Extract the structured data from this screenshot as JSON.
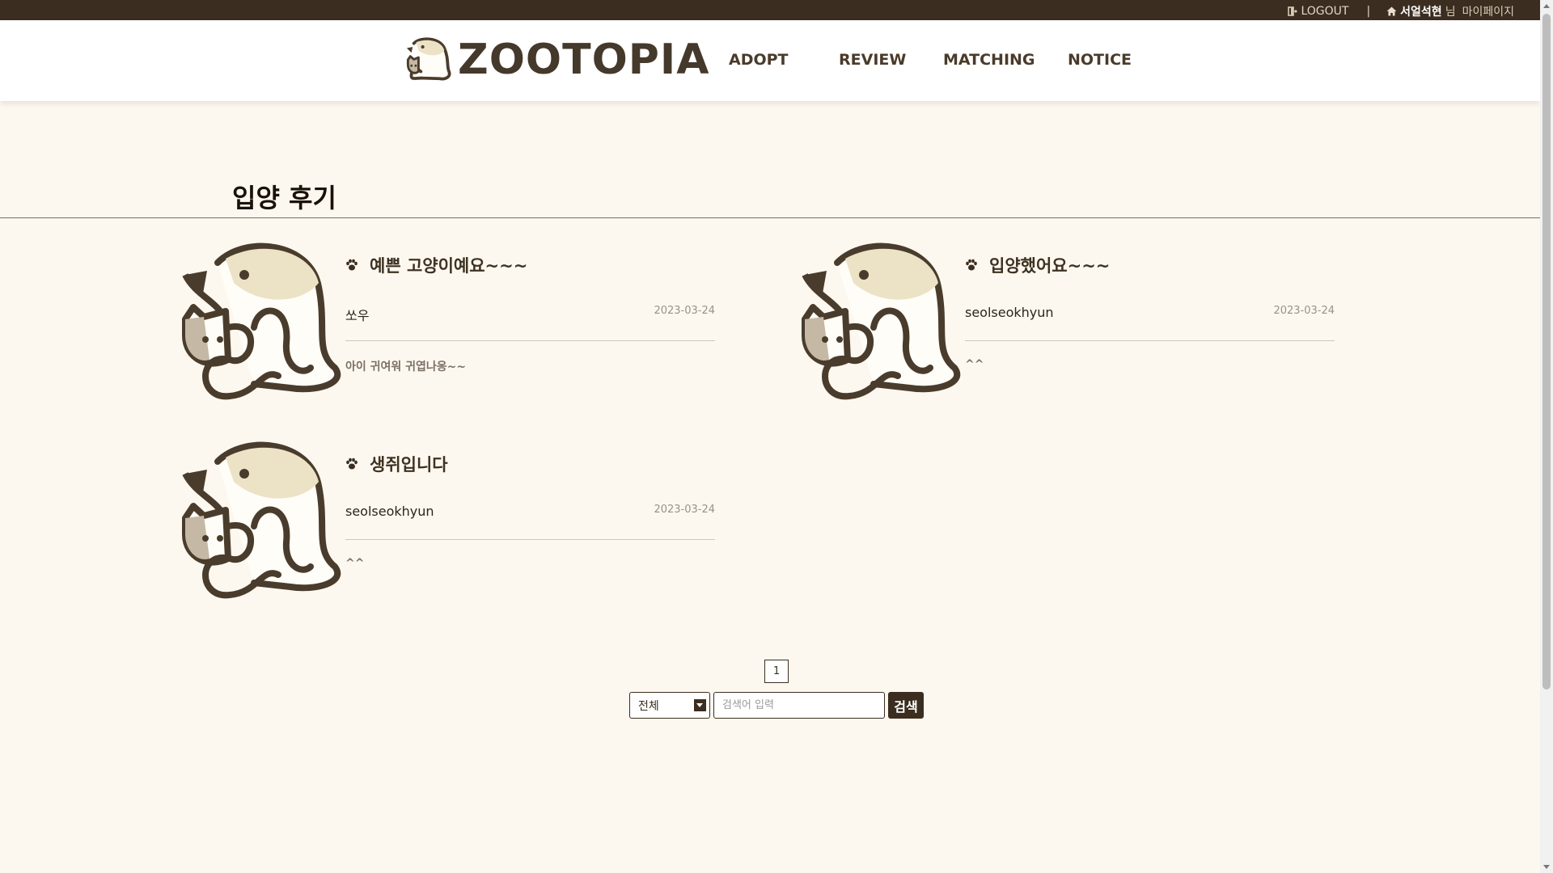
{
  "topbar": {
    "logout_label": "LOGOUT",
    "separator": "|",
    "username": "서얼석현",
    "suffix": "님",
    "mypage_label": "마이페이지"
  },
  "header": {
    "logo_text": "ZOOTOPIA",
    "nav": [
      {
        "label": "ADOPT"
      },
      {
        "label": "REVIEW"
      },
      {
        "label": "MATCHING"
      },
      {
        "label": "NOTICE"
      }
    ]
  },
  "page": {
    "title": "입양 후기"
  },
  "reviews": [
    {
      "title": "예쁜 고양이예요~~~",
      "author": "쏘우",
      "date": "2023-03-24",
      "body": "아이 귀여워 귀엽나옹~~"
    },
    {
      "title": "입양했어요~~~",
      "author": "seolseokhyun",
      "date": "2023-03-24",
      "body": "^^"
    },
    {
      "title": "생쥐입니다",
      "author": "seolseokhyun",
      "date": "2023-03-24",
      "body": "^^"
    }
  ],
  "pagination": {
    "current_page": "1"
  },
  "search": {
    "select_value": "전체",
    "input_placeholder": "검색어 입력",
    "button_label": "검색"
  },
  "colors": {
    "brand_dark": "#3b2d1f",
    "background": "#fdf8ef",
    "accent_cream": "#ece2c6"
  }
}
